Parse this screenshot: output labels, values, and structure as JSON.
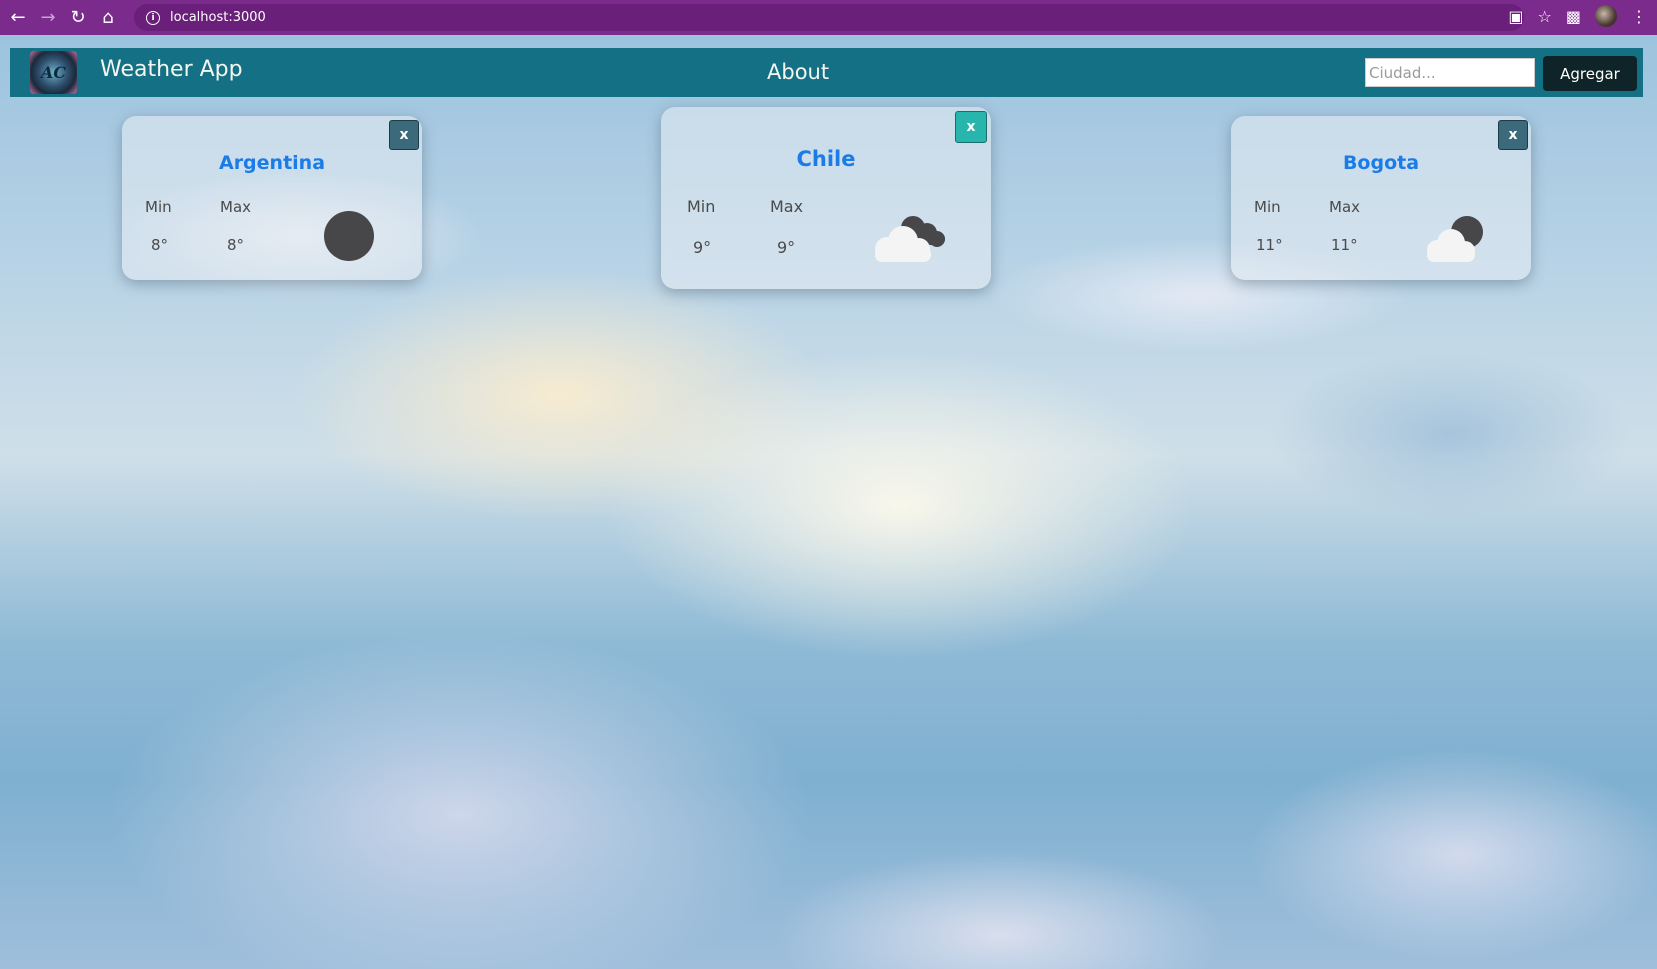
{
  "browser": {
    "url": "localhost:3000",
    "icons": [
      "back-icon",
      "forward-icon",
      "reload-icon",
      "home-icon",
      "info-icon",
      "translate-icon",
      "star-icon",
      "extensions-icon",
      "profile-avatar",
      "menu-icon"
    ]
  },
  "navbar": {
    "brand": "Weather App",
    "about": "About",
    "search_placeholder": "Ciudad...",
    "add_label": "Agregar",
    "logo_text": "AC"
  },
  "cards": [
    {
      "city": "Argentina",
      "min_label": "Min",
      "max_label": "Max",
      "min": "8°",
      "max": "8°",
      "close": "x",
      "icon": "night-clear-icon"
    },
    {
      "city": "Chile",
      "min_label": "Min",
      "max_label": "Max",
      "min": "9°",
      "max": "9°",
      "close": "x",
      "icon": "night-broken-clouds-icon"
    },
    {
      "city": "Bogota",
      "min_label": "Min",
      "max_label": "Max",
      "min": "11°",
      "max": "11°",
      "close": "x",
      "icon": "night-few-clouds-icon"
    }
  ]
}
